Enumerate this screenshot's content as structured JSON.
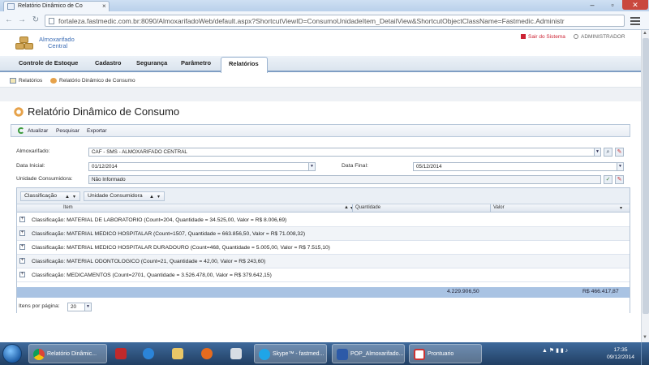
{
  "browser": {
    "tab_title": "Relatório Dinâmico de Co",
    "url": "fortaleza.fastmedic.com.br:8090/AlmoxarifadoWeb/default.aspx?ShortcutViewID=ConsumoUnidadeItem_DetailView&ShortcutObjectClassName=Fastmedic.Administr"
  },
  "app": {
    "name_line1": "Almoxarifado",
    "name_line2": "Central",
    "logout": "Sair do Sistema",
    "user": "ADMINISTRADOR"
  },
  "nav": {
    "items": [
      "Controle de Estoque",
      "Cadastro",
      "Segurança",
      "Parâmetro",
      "Relatórios"
    ]
  },
  "breadcrumb": {
    "root": "Relatórios",
    "current": "Relatório Dinâmico de Consumo"
  },
  "page": {
    "title": "Relatório Dinâmico de Consumo"
  },
  "toolbar": {
    "refresh": "Atualizar",
    "search": "Pesquisar",
    "export": "Exportar"
  },
  "form": {
    "almox_label": "Almoxarifado:",
    "almox_value": "CAF - SMS - ALMOXARIFADO CENTRAL",
    "data_inicial_label": "Data Inicial:",
    "data_inicial_value": "01/12/2014",
    "data_final_label": "Data Final:",
    "data_final_value": "05/12/2014",
    "unidade_label": "Unidade Consumidora:",
    "unidade_value": "Não Informado"
  },
  "grid": {
    "group_chips": [
      "Classificação",
      "Unidade Consumidora"
    ],
    "columns": [
      "Item",
      "Quantidade",
      "Valor"
    ],
    "rows": [
      "Classificação: MATERIAL DE LABORATORIO (Count=204, Quantidade = 34.525,00, Valor = R$ 8.006,69)",
      "Classificação: MATERIAL MEDICO HOSPITALAR (Count=1507, Quantidade = 663.856,50, Valor = R$ 71.008,32)",
      "Classificação: MATERIAL MEDICO HOSPITALAR DURADOURO (Count=468, Quantidade = 5.005,00, Valor = R$ 7.515,10)",
      "Classificação: MATERIAL ODONTOLOGICO (Count=21, Quantidade = 42,00, Valor = R$ 243,60)",
      "Classificação: MEDICAMENTOS (Count=2701, Quantidade = 3.526.478,00, Valor = R$ 379.642,15)"
    ],
    "total_quantidade": "4.229.906,50",
    "total_valor": "R$ 466.417,87",
    "pager_label": "Itens por página:",
    "pager_value": "20"
  },
  "taskbar": {
    "items": [
      "Relatório Dinâmic...",
      "Skype™ - fastmed...",
      "POP_Almoxarifado...",
      "Prontuario"
    ],
    "time": "17:35",
    "date": "09/12/2014"
  },
  "colors": {
    "nav_accent": "#7f9ec4",
    "total_row": "#a9c3e3",
    "logout_red": "#cc2233",
    "app_blue": "#3c6db5"
  }
}
